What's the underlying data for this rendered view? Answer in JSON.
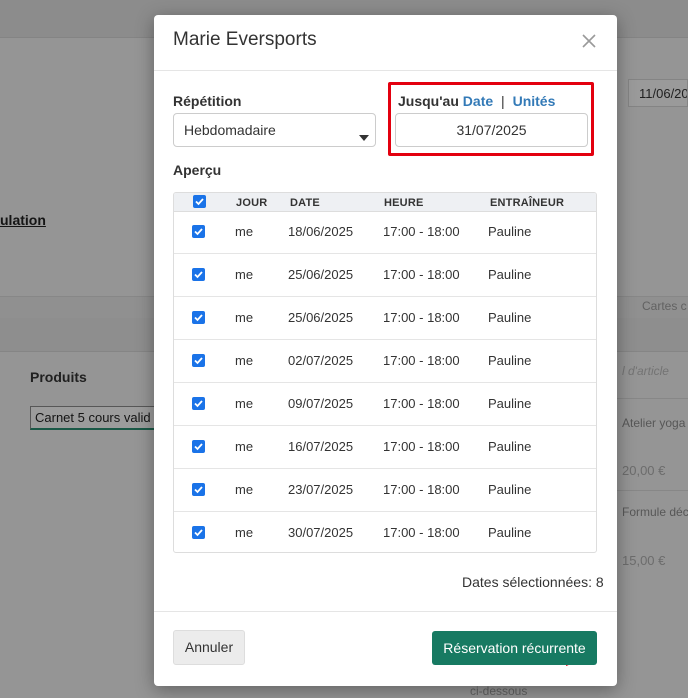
{
  "background": {
    "link_text": "ulation",
    "products_label": "Produits",
    "product_select_value": "Carnet 5 cours valid",
    "date_value": "11/06/20",
    "tab_label": "Cartes c",
    "right_items": [
      {
        "text": "l d'article",
        "style": "faint"
      },
      {
        "text": "Atelier yoga",
        "style": "normal"
      },
      {
        "text": "20,00 €",
        "style": "price"
      },
      {
        "text": "Formule déc",
        "style": "normal"
      },
      {
        "text": "15,00 €",
        "style": "price"
      }
    ],
    "bottom_text": "ci-dessous"
  },
  "modal": {
    "title": "Marie Eversports",
    "repetition": {
      "label": "Répétition",
      "value": "Hebdomadaire"
    },
    "until": {
      "label": "Jusqu'au",
      "option_date": "Date",
      "separator": "|",
      "option_units": "Unités",
      "date_value": "31/07/2025"
    },
    "preview": {
      "label": "Aperçu",
      "columns": [
        "JOUR",
        "DATE",
        "HEURE",
        "ENTRAÎNEUR"
      ],
      "rows": [
        {
          "day": "me",
          "date": "18/06/2025",
          "time": "17:00 - 18:00",
          "coach": "Pauline",
          "checked": true
        },
        {
          "day": "me",
          "date": "25/06/2025",
          "time": "17:00 - 18:00",
          "coach": "Pauline",
          "checked": true
        },
        {
          "day": "me",
          "date": "25/06/2025",
          "time": "17:00 - 18:00",
          "coach": "Pauline",
          "checked": true
        },
        {
          "day": "me",
          "date": "02/07/2025",
          "time": "17:00 - 18:00",
          "coach": "Pauline",
          "checked": true
        },
        {
          "day": "me",
          "date": "09/07/2025",
          "time": "17:00 - 18:00",
          "coach": "Pauline",
          "checked": true
        },
        {
          "day": "me",
          "date": "16/07/2025",
          "time": "17:00 - 18:00",
          "coach": "Pauline",
          "checked": true
        },
        {
          "day": "me",
          "date": "23/07/2025",
          "time": "17:00 - 18:00",
          "coach": "Pauline",
          "checked": true
        },
        {
          "day": "me",
          "date": "30/07/2025",
          "time": "17:00 - 18:00",
          "coach": "Pauline",
          "checked": true
        }
      ]
    },
    "selected_dates": "Dates sélectionnées: 8",
    "cancel_label": "Annuler",
    "submit_label": "Réservation récurrente"
  },
  "colors": {
    "primary_button": "#177a62",
    "link": "#337ab7",
    "checkbox": "#1a73e8",
    "highlight": "#e3000f"
  },
  "icons": [
    "close-icon",
    "caret-down-icon",
    "checkbox-checked-icon",
    "red-arrow-icon"
  ]
}
